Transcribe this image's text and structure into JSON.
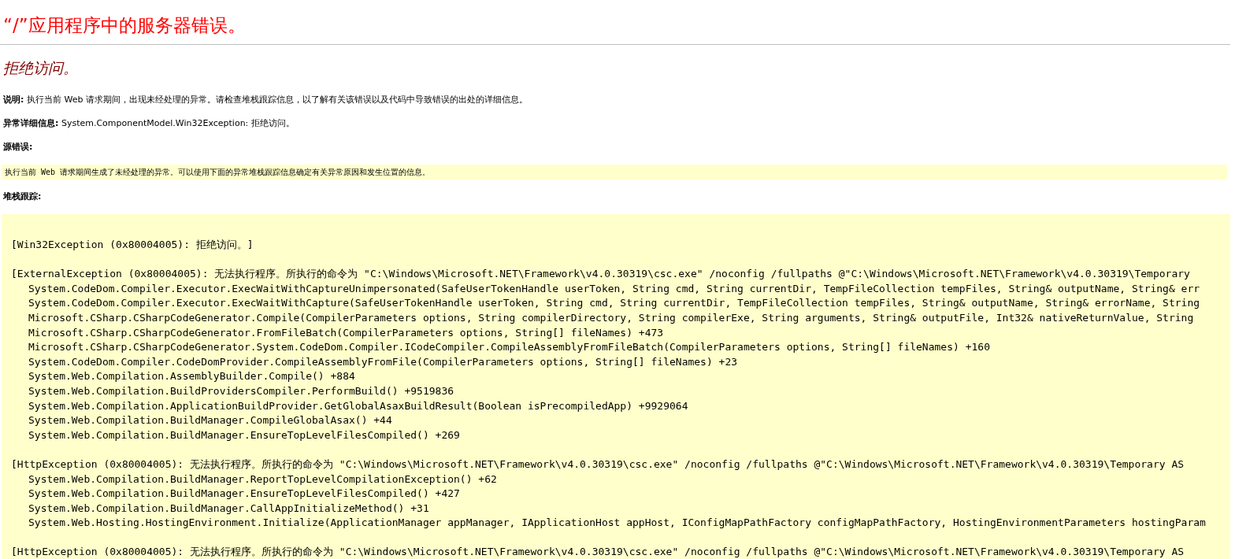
{
  "page_title": "“/”应用程序中的服务器错误。",
  "error_title": "拒绝访问。",
  "description": {
    "label": "说明:",
    "text": "执行当前 Web 请求期间，出现未经处理的异常。请检查堆栈跟踪信息，以了解有关该错误以及代码中导致错误的出处的详细信息。"
  },
  "exception_details": {
    "label": "异常详细信息:",
    "text": "System.ComponentModel.Win32Exception: 拒绝访问。"
  },
  "source_error": {
    "label": "源错误:",
    "message": "执行当前 Web 请求期间生成了未经处理的异常。可以使用下面的异常堆栈跟踪信息确定有关异常原因和发生位置的信息。"
  },
  "stack_trace": {
    "label": "堆栈跟踪:",
    "groups": [
      {
        "header": "[Win32Exception (0x80004005): 拒绝访问。]"
      },
      {
        "header": "[ExternalException (0x80004005): 无法执行程序。所执行的命令为 \"C:\\Windows\\Microsoft.NET\\Framework\\v4.0.30319\\csc.exe\" /noconfig /fullpaths @\"C:\\Windows\\Microsoft.NET\\Framework\\v4.0.30319\\Temporary",
        "frames": [
          "System.CodeDom.Compiler.Executor.ExecWaitWithCaptureUnimpersonated(SafeUserTokenHandle userToken, String cmd, String currentDir, TempFileCollection tempFiles, String& outputName, String& err",
          "System.CodeDom.Compiler.Executor.ExecWaitWithCapture(SafeUserTokenHandle userToken, String cmd, String currentDir, TempFileCollection tempFiles, String& outputName, String& errorName, String",
          "Microsoft.CSharp.CSharpCodeGenerator.Compile(CompilerParameters options, String compilerDirectory, String compilerExe, String arguments, String& outputFile, Int32& nativeReturnValue, String",
          "Microsoft.CSharp.CSharpCodeGenerator.FromFileBatch(CompilerParameters options, String[] fileNames) +473",
          "Microsoft.CSharp.CSharpCodeGenerator.System.CodeDom.Compiler.ICodeCompiler.CompileAssemblyFromFileBatch(CompilerParameters options, String[] fileNames) +160",
          "System.CodeDom.Compiler.CodeDomProvider.CompileAssemblyFromFile(CompilerParameters options, String[] fileNames) +23",
          "System.Web.Compilation.AssemblyBuilder.Compile() +884",
          "System.Web.Compilation.BuildProvidersCompiler.PerformBuild() +9519836",
          "System.Web.Compilation.ApplicationBuildProvider.GetGlobalAsaxBuildResult(Boolean isPrecompiledApp) +9929064",
          "System.Web.Compilation.BuildManager.CompileGlobalAsax() +44",
          "System.Web.Compilation.BuildManager.EnsureTopLevelFilesCompiled() +269"
        ]
      },
      {
        "header": "[HttpException (0x80004005): 无法执行程序。所执行的命令为 \"C:\\Windows\\Microsoft.NET\\Framework\\v4.0.30319\\csc.exe\" /noconfig /fullpaths @\"C:\\Windows\\Microsoft.NET\\Framework\\v4.0.30319\\Temporary AS",
        "frames": [
          "System.Web.Compilation.BuildManager.ReportTopLevelCompilationException() +62",
          "System.Web.Compilation.BuildManager.EnsureTopLevelFilesCompiled() +427",
          "System.Web.Compilation.BuildManager.CallAppInitializeMethod() +31",
          "System.Web.Hosting.HostingEnvironment.Initialize(ApplicationManager appManager, IApplicationHost appHost, IConfigMapPathFactory configMapPathFactory, HostingEnvironmentParameters hostingParam"
        ]
      },
      {
        "header": "[HttpException (0x80004005): 无法执行程序。所执行的命令为 \"C:\\Windows\\Microsoft.NET\\Framework\\v4.0.30319\\csc.exe\" /noconfig /fullpaths @\"C:\\Windows\\Microsoft.NET\\Framework\\v4.0.30319\\Temporary AS"
      }
    ]
  }
}
